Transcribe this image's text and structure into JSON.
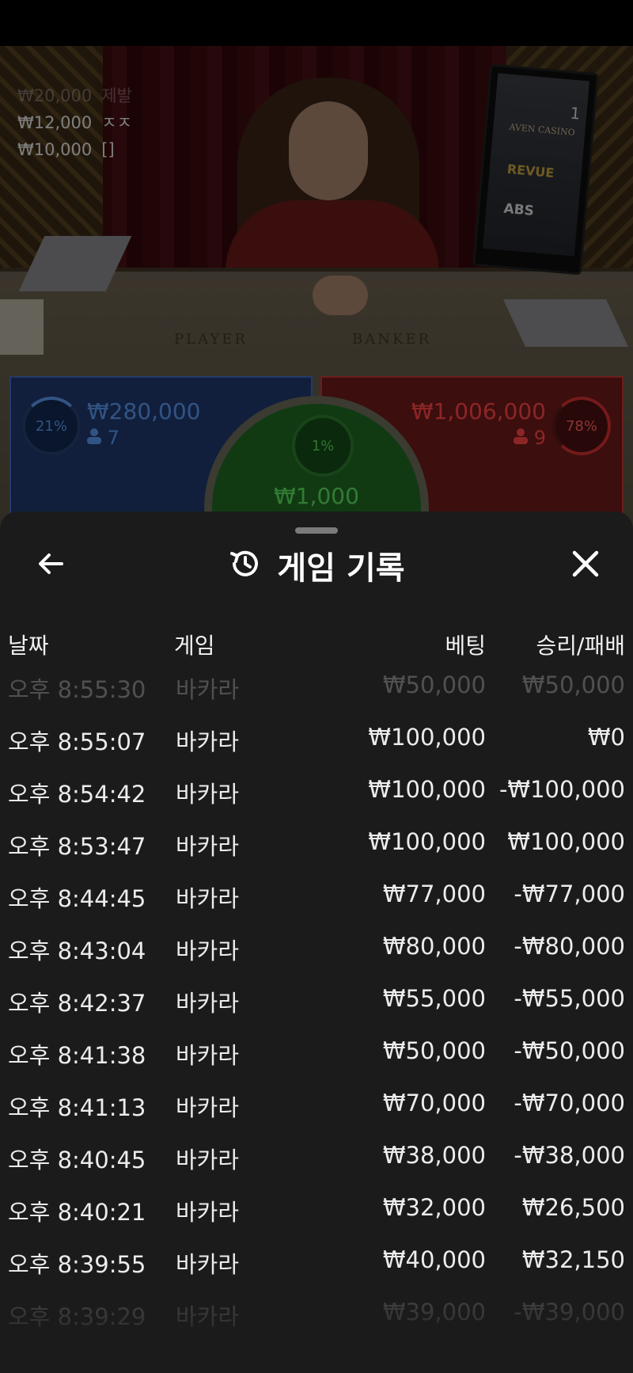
{
  "live": {
    "recent_bets": [
      {
        "amount": "₩20,000",
        "label": "제발"
      },
      {
        "amount": "₩12,000",
        "label": "ㅈㅈ"
      },
      {
        "amount": "₩10,000",
        "label": "[]"
      }
    ],
    "monitor": {
      "round": "1",
      "logo1": "AVEN CASINO",
      "logo2": "REVUE",
      "logo3": "ABS"
    },
    "table_labels": {
      "player": "PLAYER",
      "banker": "BANKER"
    },
    "player": {
      "percent": "21%",
      "amount": "₩280,000",
      "players": "7"
    },
    "banker": {
      "percent": "78%",
      "amount": "₩1,006,000",
      "players": "9"
    },
    "tie": {
      "percent": "1%",
      "amount": "₩1,000"
    }
  },
  "history": {
    "title": "게임 기록",
    "columns": {
      "date": "날짜",
      "game": "게임",
      "bet": "베팅",
      "winloss": "승리/패배"
    },
    "rows": [
      {
        "time": "오후 8:55:30",
        "game": "바카라",
        "bet": "₩50,000",
        "result": "₩50,000"
      },
      {
        "time": "오후 8:55:07",
        "game": "바카라",
        "bet": "₩100,000",
        "result": "₩0"
      },
      {
        "time": "오후 8:54:42",
        "game": "바카라",
        "bet": "₩100,000",
        "result": "-₩100,000"
      },
      {
        "time": "오후 8:53:47",
        "game": "바카라",
        "bet": "₩100,000",
        "result": "₩100,000"
      },
      {
        "time": "오후 8:44:45",
        "game": "바카라",
        "bet": "₩77,000",
        "result": "-₩77,000"
      },
      {
        "time": "오후 8:43:04",
        "game": "바카라",
        "bet": "₩80,000",
        "result": "-₩80,000"
      },
      {
        "time": "오후 8:42:37",
        "game": "바카라",
        "bet": "₩55,000",
        "result": "-₩55,000"
      },
      {
        "time": "오후 8:41:38",
        "game": "바카라",
        "bet": "₩50,000",
        "result": "-₩50,000"
      },
      {
        "time": "오후 8:41:13",
        "game": "바카라",
        "bet": "₩70,000",
        "result": "-₩70,000"
      },
      {
        "time": "오후 8:40:45",
        "game": "바카라",
        "bet": "₩38,000",
        "result": "-₩38,000"
      },
      {
        "time": "오후 8:40:21",
        "game": "바카라",
        "bet": "₩32,000",
        "result": "₩26,500"
      },
      {
        "time": "오후 8:39:55",
        "game": "바카라",
        "bet": "₩40,000",
        "result": "₩32,150"
      },
      {
        "time": "오후 8:39:29",
        "game": "바카라",
        "bet": "₩39,000",
        "result": "-₩39,000"
      }
    ]
  },
  "icons": {
    "back": "arrow-left-icon",
    "history": "history-clock-icon",
    "close": "close-icon",
    "person": "person-icon"
  },
  "colors": {
    "player_blue": "#5c9af0",
    "banker_red": "#ff4545",
    "tie_green": "#5be05f",
    "sheet_bg": "#1b1b1b"
  }
}
